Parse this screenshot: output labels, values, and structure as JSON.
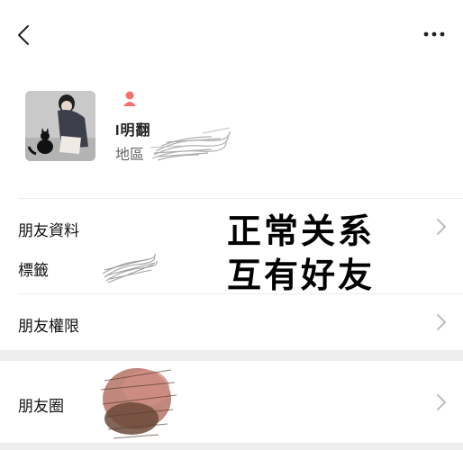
{
  "profile": {
    "name": "I明翻",
    "region_label": "地區"
  },
  "list": {
    "friend_info": "朋友資料",
    "tags": "標籤",
    "permissions": "朋友權限",
    "moments": "朋友圈"
  },
  "overlay": {
    "line1": "正常关系",
    "line2": "互有好友"
  },
  "colors": {
    "accent_female": "#f2736b",
    "chevron": "#b5b5b5",
    "band": "#ededed"
  },
  "icons": {
    "back": "chevron-left-icon",
    "more": "more-dots-icon",
    "gender": "female-icon"
  }
}
